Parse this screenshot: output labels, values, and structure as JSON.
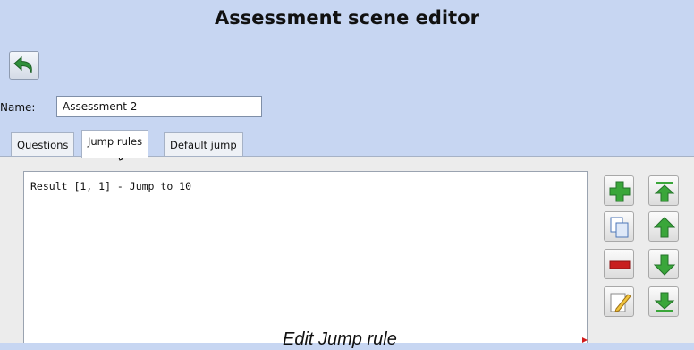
{
  "window": {
    "title": "Assessment scene editor"
  },
  "toolbar": {
    "back_icon": "undo-arrow-icon"
  },
  "form": {
    "name_label": "Name:",
    "name_value": "Assessment 2"
  },
  "tabs": [
    {
      "label": "Questions",
      "active": false
    },
    {
      "label": "Jump rules",
      "active": true
    },
    {
      "label": "Default jump",
      "active": false
    }
  ],
  "rules": {
    "items": [
      "Result [1, 1] - Jump to 10"
    ]
  },
  "actions": {
    "left": [
      "add-icon",
      "duplicate-icon",
      "remove-icon",
      "edit-icon"
    ],
    "right": [
      "move-top-icon",
      "move-up-icon",
      "move-down-icon",
      "move-bottom-icon"
    ]
  },
  "caption": "Edit Jump rule",
  "colors": {
    "background": "#c7d6f2",
    "panel": "#ececec",
    "green": "#3aa63a",
    "red": "#c81e1e"
  }
}
